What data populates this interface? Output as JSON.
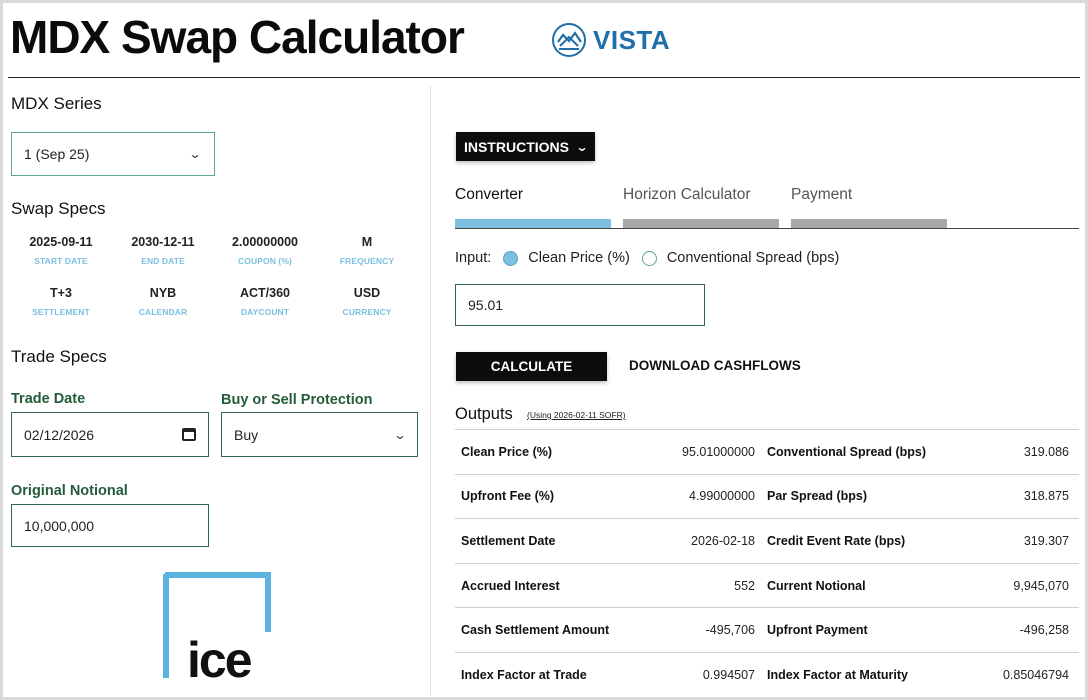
{
  "header": {
    "title": "MDX Swap Calculator",
    "brand": "VISTA",
    "brand_color": "#1f6fa8"
  },
  "mdx_series": {
    "label": "MDX Series",
    "selected": "1 (Sep 25)"
  },
  "swap_specs": {
    "title": "Swap Specs",
    "row1": [
      {
        "value": "2025-09-11",
        "label": "START DATE"
      },
      {
        "value": "2030-12-11",
        "label": "END DATE"
      },
      {
        "value": "2.00000000",
        "label": "COUPON (%)"
      },
      {
        "value": "M",
        "label": "FREQUENCY"
      }
    ],
    "row2": [
      {
        "value": "T+3",
        "label": "SETTLEMENT"
      },
      {
        "value": "NYB",
        "label": "CALENDAR"
      },
      {
        "value": "ACT/360",
        "label": "DAYCOUNT"
      },
      {
        "value": "USD",
        "label": "CURRENCY"
      }
    ]
  },
  "trade_specs": {
    "title": "Trade Specs",
    "trade_date_label": "Trade Date",
    "trade_date_value": "02/12/2026",
    "protection_label": "Buy or Sell Protection",
    "protection_value": "Buy",
    "notional_label": "Original Notional",
    "notional_value": "10,000,000"
  },
  "brand_footer": {
    "text": "ice",
    "color": "#5ab4e0"
  },
  "right": {
    "instructions_label": "INSTRUCTIONS",
    "tabs": [
      {
        "label": "Converter",
        "active": true
      },
      {
        "label": "Horizon Calculator",
        "active": false
      },
      {
        "label": "Payment",
        "active": false
      }
    ],
    "input_label": "Input:",
    "radio_options": [
      {
        "label": "Clean Price (%)",
        "checked": true
      },
      {
        "label": "Conventional Spread (bps)",
        "checked": false
      }
    ],
    "input_value": "95.01",
    "calculate_label": "CALCULATE",
    "download_label": "DOWNLOAD CASHFLOWS",
    "outputs_title": "Outputs",
    "outputs_subtitle": "(Using 2026-02-11 SOFR)",
    "outputs": [
      {
        "l1": "Clean Price (%)",
        "v1": "95.01000000",
        "l2": "Conventional Spread (bps)",
        "v2": "319.086"
      },
      {
        "l1": "Upfront Fee (%)",
        "v1": "4.99000000",
        "l2": "Par Spread (bps)",
        "v2": "318.875"
      },
      {
        "l1": "Settlement Date",
        "v1": "2026-02-18",
        "l2": "Credit Event Rate (bps)",
        "v2": "319.307"
      },
      {
        "l1": "Accrued Interest",
        "v1": "552",
        "l2": "Current Notional",
        "v2": "9,945,070"
      },
      {
        "l1": "Cash Settlement Amount",
        "v1": "-495,706",
        "l2": "Upfront Payment",
        "v2": "-496,258"
      },
      {
        "l1": "Index Factor at Trade",
        "v1": "0.994507",
        "l2": "Index Factor at Maturity",
        "v2": "0.85046794"
      }
    ]
  }
}
